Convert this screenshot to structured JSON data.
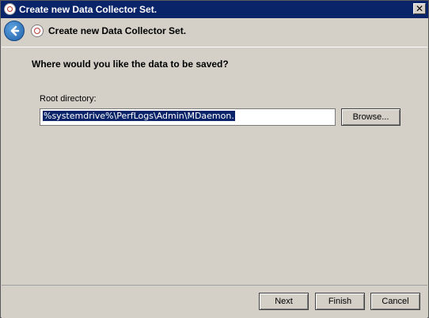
{
  "window": {
    "title": "Create new Data Collector Set."
  },
  "header": {
    "title": "Create new Data Collector Set."
  },
  "page": {
    "question": "Where would you like the data to be saved?",
    "root_directory_label": "Root directory:",
    "root_directory_value": "%systemdrive%\\PerfLogs\\Admin\\MDaemon."
  },
  "buttons": {
    "browse": "Browse...",
    "next": "Next",
    "finish": "Finish",
    "cancel": "Cancel",
    "close": "✕"
  },
  "colors": {
    "titlebar": "#0a246a",
    "dialog_background": "#d4d0c8",
    "selection": "#0a246a"
  },
  "icons": {
    "app": "data-collector-icon",
    "back": "back-arrow-icon",
    "close": "close-icon"
  }
}
